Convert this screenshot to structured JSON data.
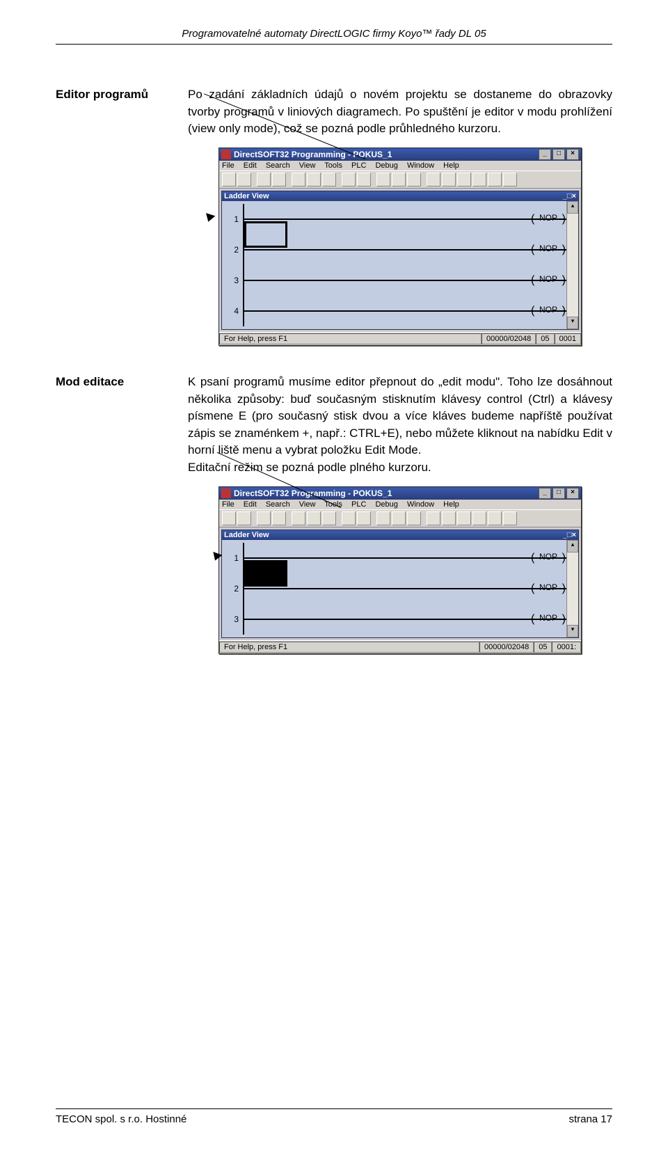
{
  "header": "Programovatelné automaty DirectLOGIC firmy Koyo™ řady DL 05",
  "sections": [
    {
      "label": "Editor programů",
      "body": "Po zadání základních údajů o novém projektu se dostaneme do obrazovky tvorby programů v liniových diagramech. Po spuštění je editor v modu prohlížení (view only mode), což se pozná podle průhledného kurzoru."
    },
    {
      "label": "Mod editace",
      "body": "K psaní programů musíme editor přepnout do „edit modu\". Toho lze dosáhnout několika způsoby: buď současným stisknutím klávesy control (Ctrl) a klávesy písmene E (pro současný stisk dvou a více kláves budeme napříště používat zápis se znaménkem +, např.: CTRL+E), nebo můžete kliknout na nabídku Edit v horní liště menu a vybrat položku Edit Mode.\nEditační režim se pozná podle plného kurzoru."
    }
  ],
  "screenshot": {
    "title": "DirectSOFT32 Programming - POKUS_1",
    "menus": [
      "File",
      "Edit",
      "Search",
      "View",
      "Tools",
      "PLC",
      "Debug",
      "Window",
      "Help"
    ],
    "inner_title": "Ladder View",
    "nop": "NOP",
    "status_help": "For Help, press F1",
    "status1": {
      "counter": "00000/02048",
      "addr": "05",
      "word": "0001"
    },
    "status2": {
      "counter": "00000/02048",
      "addr": "05",
      "word": "0001:"
    },
    "rungs1": [
      "1",
      "2",
      "3",
      "4"
    ],
    "rungs2": [
      "1",
      "2",
      "3"
    ]
  },
  "footer": {
    "left": "TECON spol. s r.o.   Hostinné",
    "right": "strana 17"
  }
}
